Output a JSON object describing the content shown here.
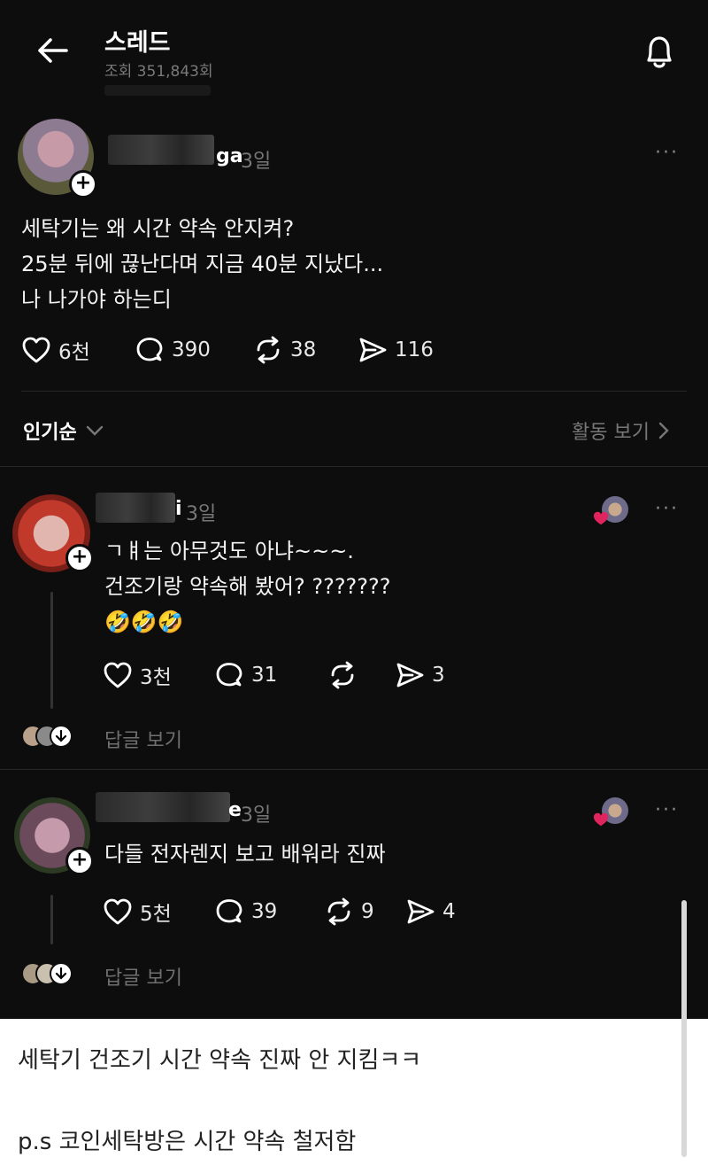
{
  "header": {
    "title": "스레드",
    "views": "조회 351,843회"
  },
  "post": {
    "author_suffix": "ga",
    "time": "3일",
    "more": "···",
    "lines": [
      "세탁기는 왜 시간 약속 안지켜?",
      "25분 뒤에 끊난다며 지금 40분 지났다...",
      "나 나가야 하는디"
    ],
    "likes": "6천",
    "comments": "390",
    "reposts": "38",
    "shares": "116"
  },
  "sort": {
    "label": "인기순",
    "activity": "활동 보기"
  },
  "replies": [
    {
      "author_suffix": "i",
      "time": "3일",
      "more": "···",
      "lines": [
        "ㄱㅒ는 아무것도 아냐~~~.",
        "건조기랑 약속해 봤어? ???????",
        "🤣🤣🤣"
      ],
      "likes": "3천",
      "comments": "31",
      "reposts": "",
      "shares": "3",
      "view_replies": "답글 보기"
    },
    {
      "author_suffix": "e",
      "time": "3일",
      "more": "···",
      "lines": [
        "다들 전자렌지 보고 배워라 진짜"
      ],
      "likes": "5천",
      "comments": "39",
      "reposts": "9",
      "shares": "4",
      "view_replies": "답글 보기"
    }
  ],
  "captions": [
    "세탁기 건조기 시간 약속 진짜 안 지킴ㅋㅋ",
    "p.s 코인세탁방은 시간 약속 철저함"
  ],
  "colors": {
    "background": "#0d0d0d",
    "text": "#f3f3f3",
    "muted": "#777777",
    "heart": "#e0245e"
  }
}
